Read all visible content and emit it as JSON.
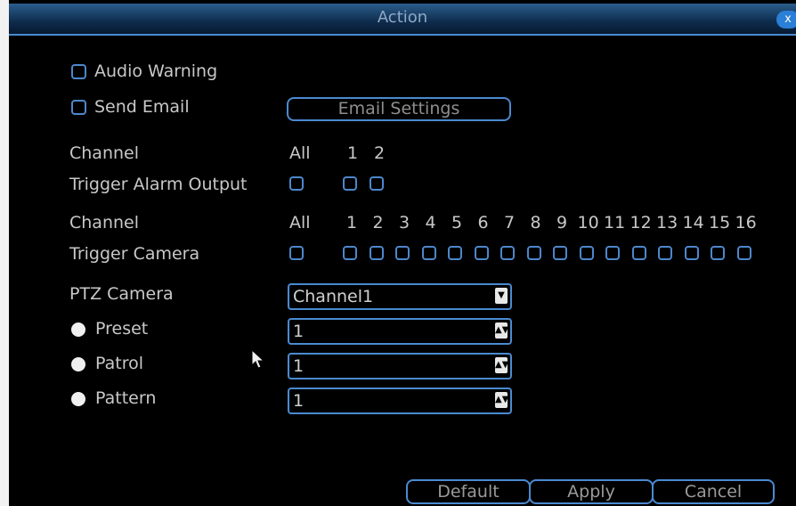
{
  "window": {
    "title": "Action",
    "close_label": "x"
  },
  "options": {
    "audio_warning": "Audio Warning",
    "send_email": "Send Email",
    "email_settings_button": "Email Settings"
  },
  "alarm_output": {
    "channel_label": "Channel",
    "trigger_label": "Trigger Alarm Output",
    "all_label": "All",
    "channels": [
      "1",
      "2"
    ]
  },
  "camera": {
    "channel_label": "Channel",
    "trigger_label": "Trigger Camera",
    "all_label": "All",
    "channels": [
      "1",
      "2",
      "3",
      "4",
      "5",
      "6",
      "7",
      "8",
      "9",
      "10",
      "11",
      "12",
      "13",
      "14",
      "15",
      "16"
    ]
  },
  "ptz": {
    "camera_label": "PTZ Camera",
    "camera_value": "Channel1",
    "preset_label": "Preset",
    "preset_value": "1",
    "patrol_label": "Patrol",
    "patrol_value": "1",
    "pattern_label": "Pattern",
    "pattern_value": "1"
  },
  "footer": {
    "default": "Default",
    "apply": "Apply",
    "cancel": "Cancel"
  }
}
